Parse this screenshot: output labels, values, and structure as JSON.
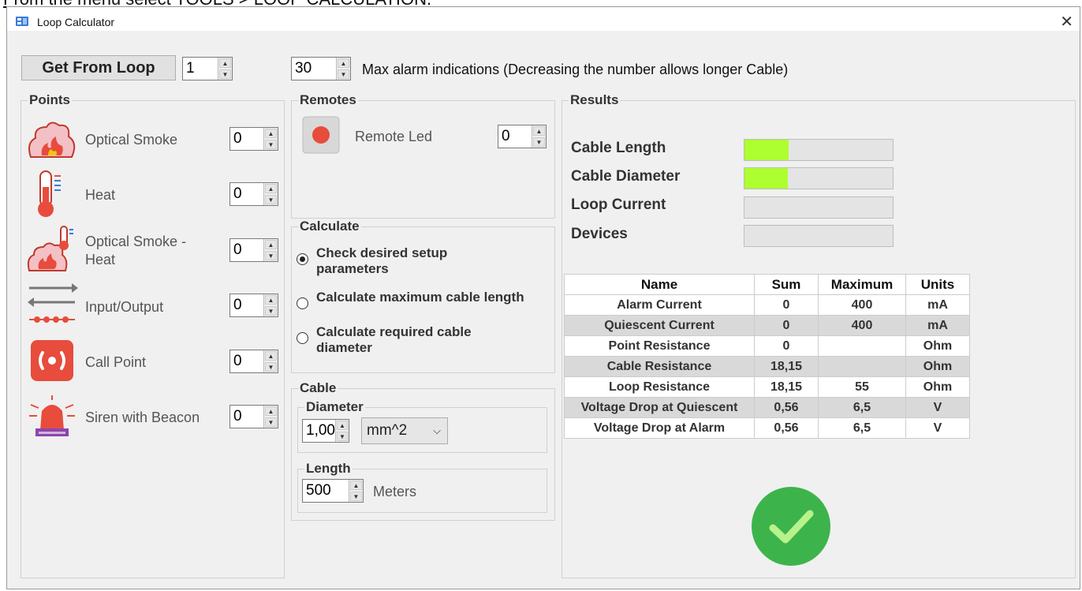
{
  "caption": "From the menu select TOOLS > LOOP CALCULATION.",
  "window": {
    "title": "Loop Calculator"
  },
  "top": {
    "get_from_loop": "Get From Loop",
    "loop_number": "1",
    "max_alarm_value": "30",
    "max_alarm_text": "Max alarm indications (Decreasing the number allows longer Cable)"
  },
  "points": {
    "title": "Points",
    "items": [
      {
        "label": "Optical Smoke",
        "value": "0"
      },
      {
        "label": "Heat",
        "value": "0"
      },
      {
        "label": "Optical Smoke -",
        "label2": "Heat",
        "value": "0"
      },
      {
        "label": "Input/Output",
        "value": "0"
      },
      {
        "label": "Call Point",
        "value": "0"
      },
      {
        "label": "Siren with Beacon",
        "value": "0"
      }
    ]
  },
  "remotes": {
    "title": "Remotes",
    "label": "Remote Led",
    "value": "0"
  },
  "calculate": {
    "title": "Calculate",
    "options": [
      {
        "line1": "Check desired setup",
        "line2": "parameters",
        "selected": true
      },
      {
        "line1": "Calculate maximum cable length",
        "line2": "",
        "selected": false
      },
      {
        "line1": "Calculate required cable",
        "line2": "diameter",
        "selected": false
      }
    ]
  },
  "cable": {
    "title": "Cable",
    "diameter_title": "Diameter",
    "diameter_value": "1,00",
    "diameter_unit": "mm^2",
    "length_title": "Length",
    "length_value": "500",
    "length_unit": "Meters"
  },
  "results": {
    "title": "Results",
    "bars": [
      {
        "label": "Cable Length",
        "fill": 0.3
      },
      {
        "label": "Cable Diameter",
        "fill": 0.29
      },
      {
        "label": "Loop Current",
        "fill": 0
      },
      {
        "label": "Devices",
        "fill": 0
      }
    ],
    "headers": [
      "Name",
      "Sum",
      "Maximum",
      "Units"
    ],
    "rows": [
      [
        "Alarm Current",
        "0",
        "400",
        "mA"
      ],
      [
        "Quiescent Current",
        "0",
        "400",
        "mA"
      ],
      [
        "Point Resistance",
        "0",
        "",
        "Ohm"
      ],
      [
        "Cable Resistance",
        "18,15",
        "",
        "Ohm"
      ],
      [
        "Loop Resistance",
        "18,15",
        "55",
        "Ohm"
      ],
      [
        "Voltage Drop at Quiescent",
        "0,56",
        "6,5",
        "V"
      ],
      [
        "Voltage Drop at Alarm",
        "0,56",
        "6,5",
        "V"
      ]
    ],
    "status_icon": "checkmark-icon",
    "status_color": "#3cb44b",
    "bar_fill_color": "#adff2f"
  }
}
